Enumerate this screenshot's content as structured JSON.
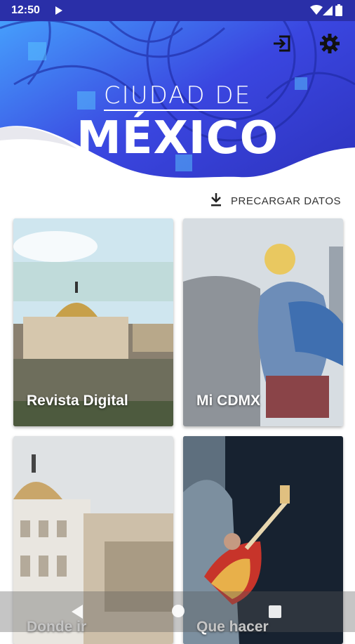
{
  "status_bar": {
    "time": "12:50"
  },
  "hero": {
    "title_top": "CIUDAD DE",
    "title_main": "MÉXICO"
  },
  "actions": {
    "preload_label": "PRECARGAR DATOS"
  },
  "cards": [
    {
      "label": "Revista Digital"
    },
    {
      "label": "Mi CDMX"
    },
    {
      "label": "Donde ir"
    },
    {
      "label": "Que hacer"
    }
  ],
  "icons": {
    "play": "play-icon",
    "wifi": "wifi-icon",
    "signal": "signal-icon",
    "battery": "battery-icon",
    "login": "login-icon",
    "settings": "gear-icon",
    "download": "download-icon",
    "back": "back-icon",
    "home": "home-icon",
    "recent": "recent-apps-icon"
  },
  "colors": {
    "status_bar": "#2a2fa8",
    "hero_primary": "#3a46e0",
    "hero_accent": "#47a8ff"
  }
}
